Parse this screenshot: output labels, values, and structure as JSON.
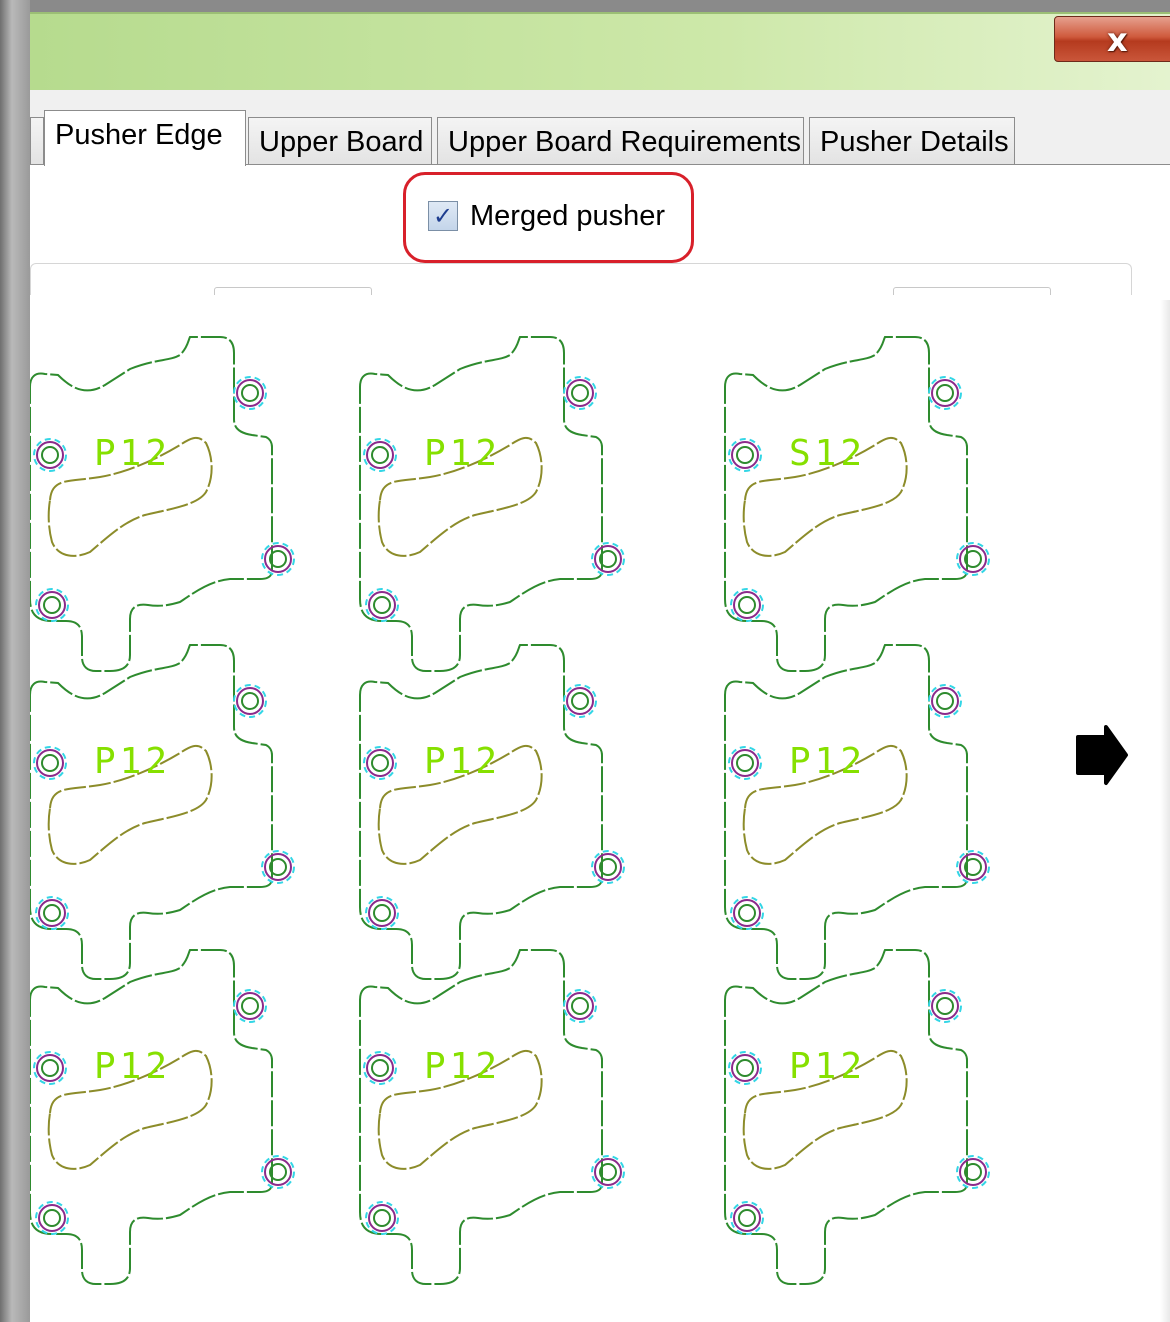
{
  "window": {
    "title": "",
    "close_glyph": "x"
  },
  "tabs": [
    {
      "label": "",
      "active": false
    },
    {
      "label": "Pusher Edge",
      "active": true
    },
    {
      "label": "Upper Board",
      "active": false
    },
    {
      "label": "Upper Board Requirements",
      "active": false
    },
    {
      "label": "Pusher Details",
      "active": false
    }
  ],
  "merged_pusher": {
    "label": "Merged pusher",
    "checked": true
  },
  "canvas": {
    "grid_rows": 3,
    "grid_cols": 3,
    "part_labels": [
      [
        "P12",
        "P12",
        "S12"
      ],
      [
        "P12",
        "P12",
        "P12"
      ],
      [
        "P12",
        "P12",
        "P12"
      ]
    ],
    "icons": {
      "next_arrow": "right-arrow-icon"
    }
  },
  "colors": {
    "outline": "#2e8b2e",
    "cutout": "#8c8c2a",
    "label": "#86e000",
    "hole_magenta": "#8b2a8b",
    "hole_cyan": "#33d6e6",
    "hole_green": "#2e8b2e",
    "highlight": "#d8202a",
    "title_bar": "#c2e29c"
  }
}
